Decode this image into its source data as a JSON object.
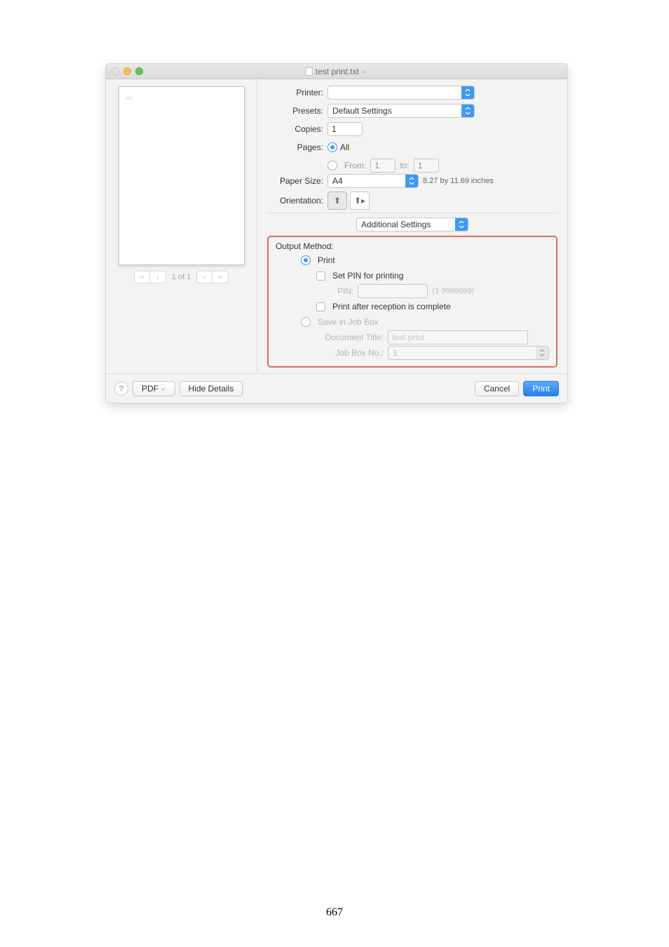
{
  "window": {
    "title": "test print.txt"
  },
  "labels": {
    "printer": "Printer:",
    "presets": "Presets:",
    "copies": "Copies:",
    "pages": "Pages:",
    "pagesAll": "All",
    "from": "From:",
    "to": "to:",
    "paperSize": "Paper Size:",
    "orientation": "Orientation:",
    "section": "Additional Settings",
    "outputMethod": "Output Method:",
    "optPrint": "Print",
    "optSetPin": "Set PIN for printing",
    "pin": "PIN:",
    "pinHint": "(1-9999999)",
    "printAfter": "Print after reception is complete",
    "saveBox": "Save in Job Box",
    "docTitle": "Document Title:",
    "jobBoxNo": "Job Box No.:"
  },
  "values": {
    "printerName": "",
    "presets": "Default Settings",
    "copies": "1",
    "pageFrom": "1",
    "pageTo": "1",
    "paperSize": "A4",
    "paperSizeInfo": "8.27 by 11.69 inches",
    "docTitlePlaceholder": "test print",
    "jobBoxNo": "1",
    "previewPageIndicator": "1 of 1"
  },
  "footer": {
    "pdf": "PDF",
    "hideDetails": "Hide Details",
    "cancel": "Cancel",
    "print": "Print"
  },
  "page_number": "667"
}
